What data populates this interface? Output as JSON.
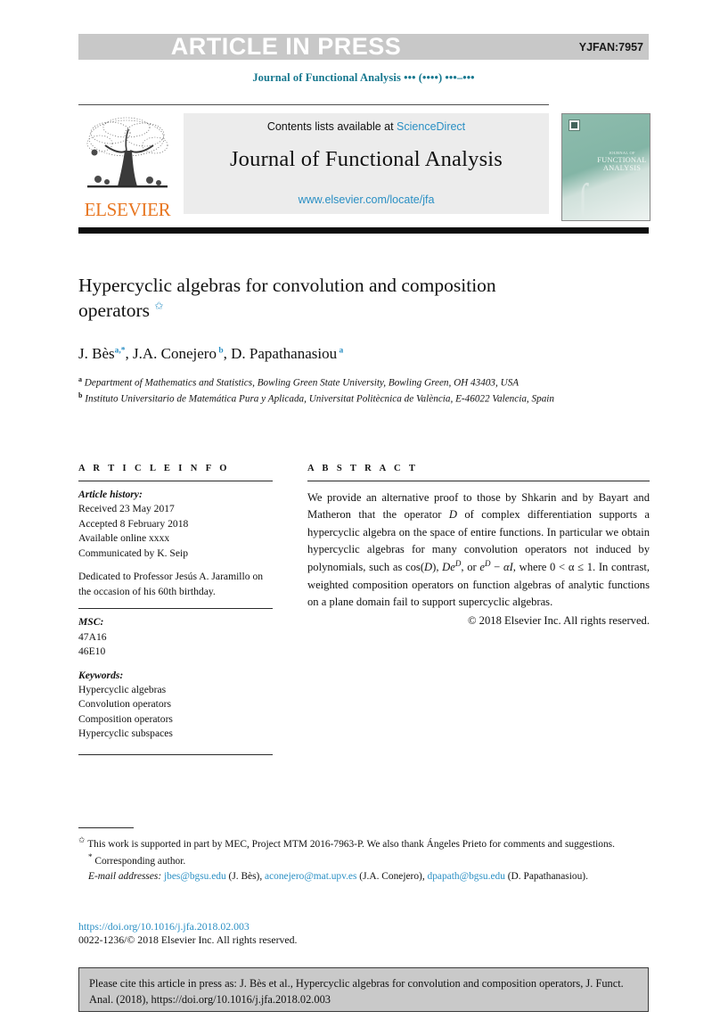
{
  "banner": {
    "label": "ARTICLE IN PRESS",
    "article_code": "YJFAN:7957",
    "bg_color": "#c8c8c8"
  },
  "running_head": "Journal of Functional Analysis ••• (••••) •••–•••",
  "masthead": {
    "contents_prefix": "Contents lists available at ",
    "sciencedirect": "ScienceDirect",
    "journal_name": "Journal of Functional Analysis",
    "journal_url": "www.elsevier.com/locate/jfa",
    "publisher": "ELSEVIER",
    "publisher_color": "#e87722",
    "link_color": "#2a8fc4",
    "cover": {
      "line1": "JOURNAL OF",
      "line2": "FUNCTIONAL",
      "line3": "ANALYSIS"
    }
  },
  "article": {
    "title": "Hypercyclic algebras for convolution and composition operators",
    "title_footnote_symbol": "✩",
    "authors_html": "J. Bès <sup>a,*</sup>, J.A. Conejero <sup>b</sup>, D. Papathanasiou <sup>a</sup>",
    "authors_plain": "J. Bès a,*, J.A. Conejero b, D. Papathanasiou a",
    "affiliations": [
      {
        "mark": "a",
        "text": "Department of Mathematics and Statistics, Bowling Green State University, Bowling Green, OH 43403, USA"
      },
      {
        "mark": "b",
        "text": "Instituto Universitario de Matemática Pura y Aplicada, Universitat Politècnica de València, E-46022 Valencia, Spain"
      }
    ]
  },
  "info": {
    "heading": "A R T I C L E   I N F O",
    "history_label": "Article history:",
    "history": [
      "Received 23 May 2017",
      "Accepted 8 February 2018",
      "Available online xxxx",
      "Communicated by K. Seip"
    ],
    "dedication": "Dedicated to Professor Jesús A. Jaramillo on the occasion of his 60th birthday.",
    "msc_label": "MSC:",
    "msc": [
      "47A16",
      "46E10"
    ],
    "keywords_label": "Keywords:",
    "keywords": [
      "Hypercyclic algebras",
      "Convolution operators",
      "Composition operators",
      "Hypercyclic subspaces"
    ]
  },
  "abstract": {
    "heading": "A B S T R A C T",
    "paragraph_1": "We provide an alternative proof to those by Shkarin and by Bayart and Matheron that the operator ",
    "operator_D": "D",
    "paragraph_2": " of complex differentiation supports a hypercyclic algebra on the space of entire functions. In particular we obtain hypercyclic algebras for many convolution operators not induced by polynomials, such as cos(",
    "paragraph_3": "), ",
    "expr_DeD_base": "De",
    "expr_DeD_sup": "D",
    "paragraph_4": ", or ",
    "expr_eD_base": "e",
    "expr_eD_sup": "D",
    "paragraph_5": " − ",
    "alpha_I": "αI",
    "paragraph_6": ", where 0 < α ≤ 1. In contrast, weighted composition operators on function algebras of analytic functions on a plane domain fail to support supercyclic algebras.",
    "copyright": "© 2018 Elsevier Inc. All rights reserved."
  },
  "footnotes": {
    "funding_mark": "✩",
    "funding": "This work is supported in part by MEC, Project MTM 2016-7963-P. We also thank Ángeles Prieto for comments and suggestions.",
    "corresponding_mark": "*",
    "corresponding": "Corresponding author.",
    "email_label": "E-mail addresses:",
    "emails": [
      {
        "address": "jbes@bgsu.edu",
        "owner": "(J. Bès)"
      },
      {
        "address": "aconejero@mat.upv.es",
        "owner": "(J.A. Conejero)"
      },
      {
        "address": "dpapath@bgsu.edu",
        "owner": "(D. Papathanasiou)"
      }
    ],
    "doi": "https://doi.org/10.1016/j.jfa.2018.02.003",
    "issn_line": "0022-1236/© 2018 Elsevier Inc. All rights reserved."
  },
  "cite_box": {
    "text": "Please cite this article in press as: J. Bès et al., Hypercyclic algebras for convolution and composition operators, J. Funct. Anal. (2018), https://doi.org/10.1016/j.jfa.2018.02.003"
  }
}
